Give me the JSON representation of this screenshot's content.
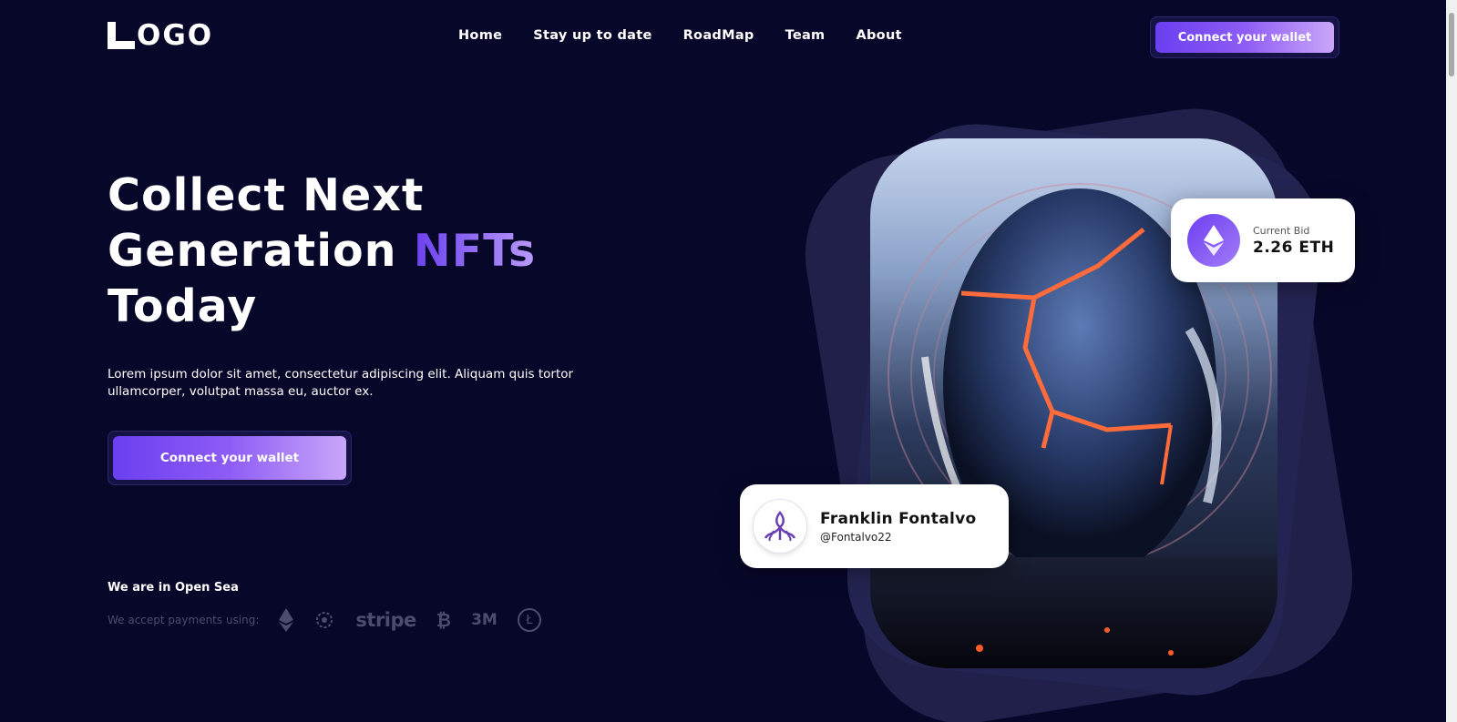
{
  "logo": {
    "text": "OGO"
  },
  "nav": {
    "items": [
      "Home",
      "Stay up to date",
      "RoadMap",
      "Team",
      "About"
    ]
  },
  "header": {
    "cta_label": "Connect your wallet"
  },
  "hero": {
    "title_line1": "Collect Next",
    "title_line2_plain": "Generation ",
    "title_line2_accent": "NFTs",
    "title_line3": "Today",
    "description": "Lorem ipsum dolor sit amet, consectetur adipiscing elit. Aliquam quis tortor ullamcorper, volutpat massa eu, auctor ex.",
    "cta_label": "Connect your wallet"
  },
  "marketplace": {
    "heading": "We are in Open Sea",
    "payments_label": "We accept payments using:",
    "payment_icons": [
      "ethereum-icon",
      "cardano-icon",
      "stripe-logo",
      "bitcoin-icon",
      "3m-logo",
      "litecoin-icon"
    ],
    "stripe_text": "stripe",
    "b3m_text": "3M"
  },
  "bid_card": {
    "label": "Current Bid",
    "value": "2.26 ETH"
  },
  "creator_card": {
    "name": "Franklin Fontalvo",
    "handle": "@Fontalvo22"
  },
  "colors": {
    "background": "#07072a",
    "accent": "#7e5cf5"
  }
}
